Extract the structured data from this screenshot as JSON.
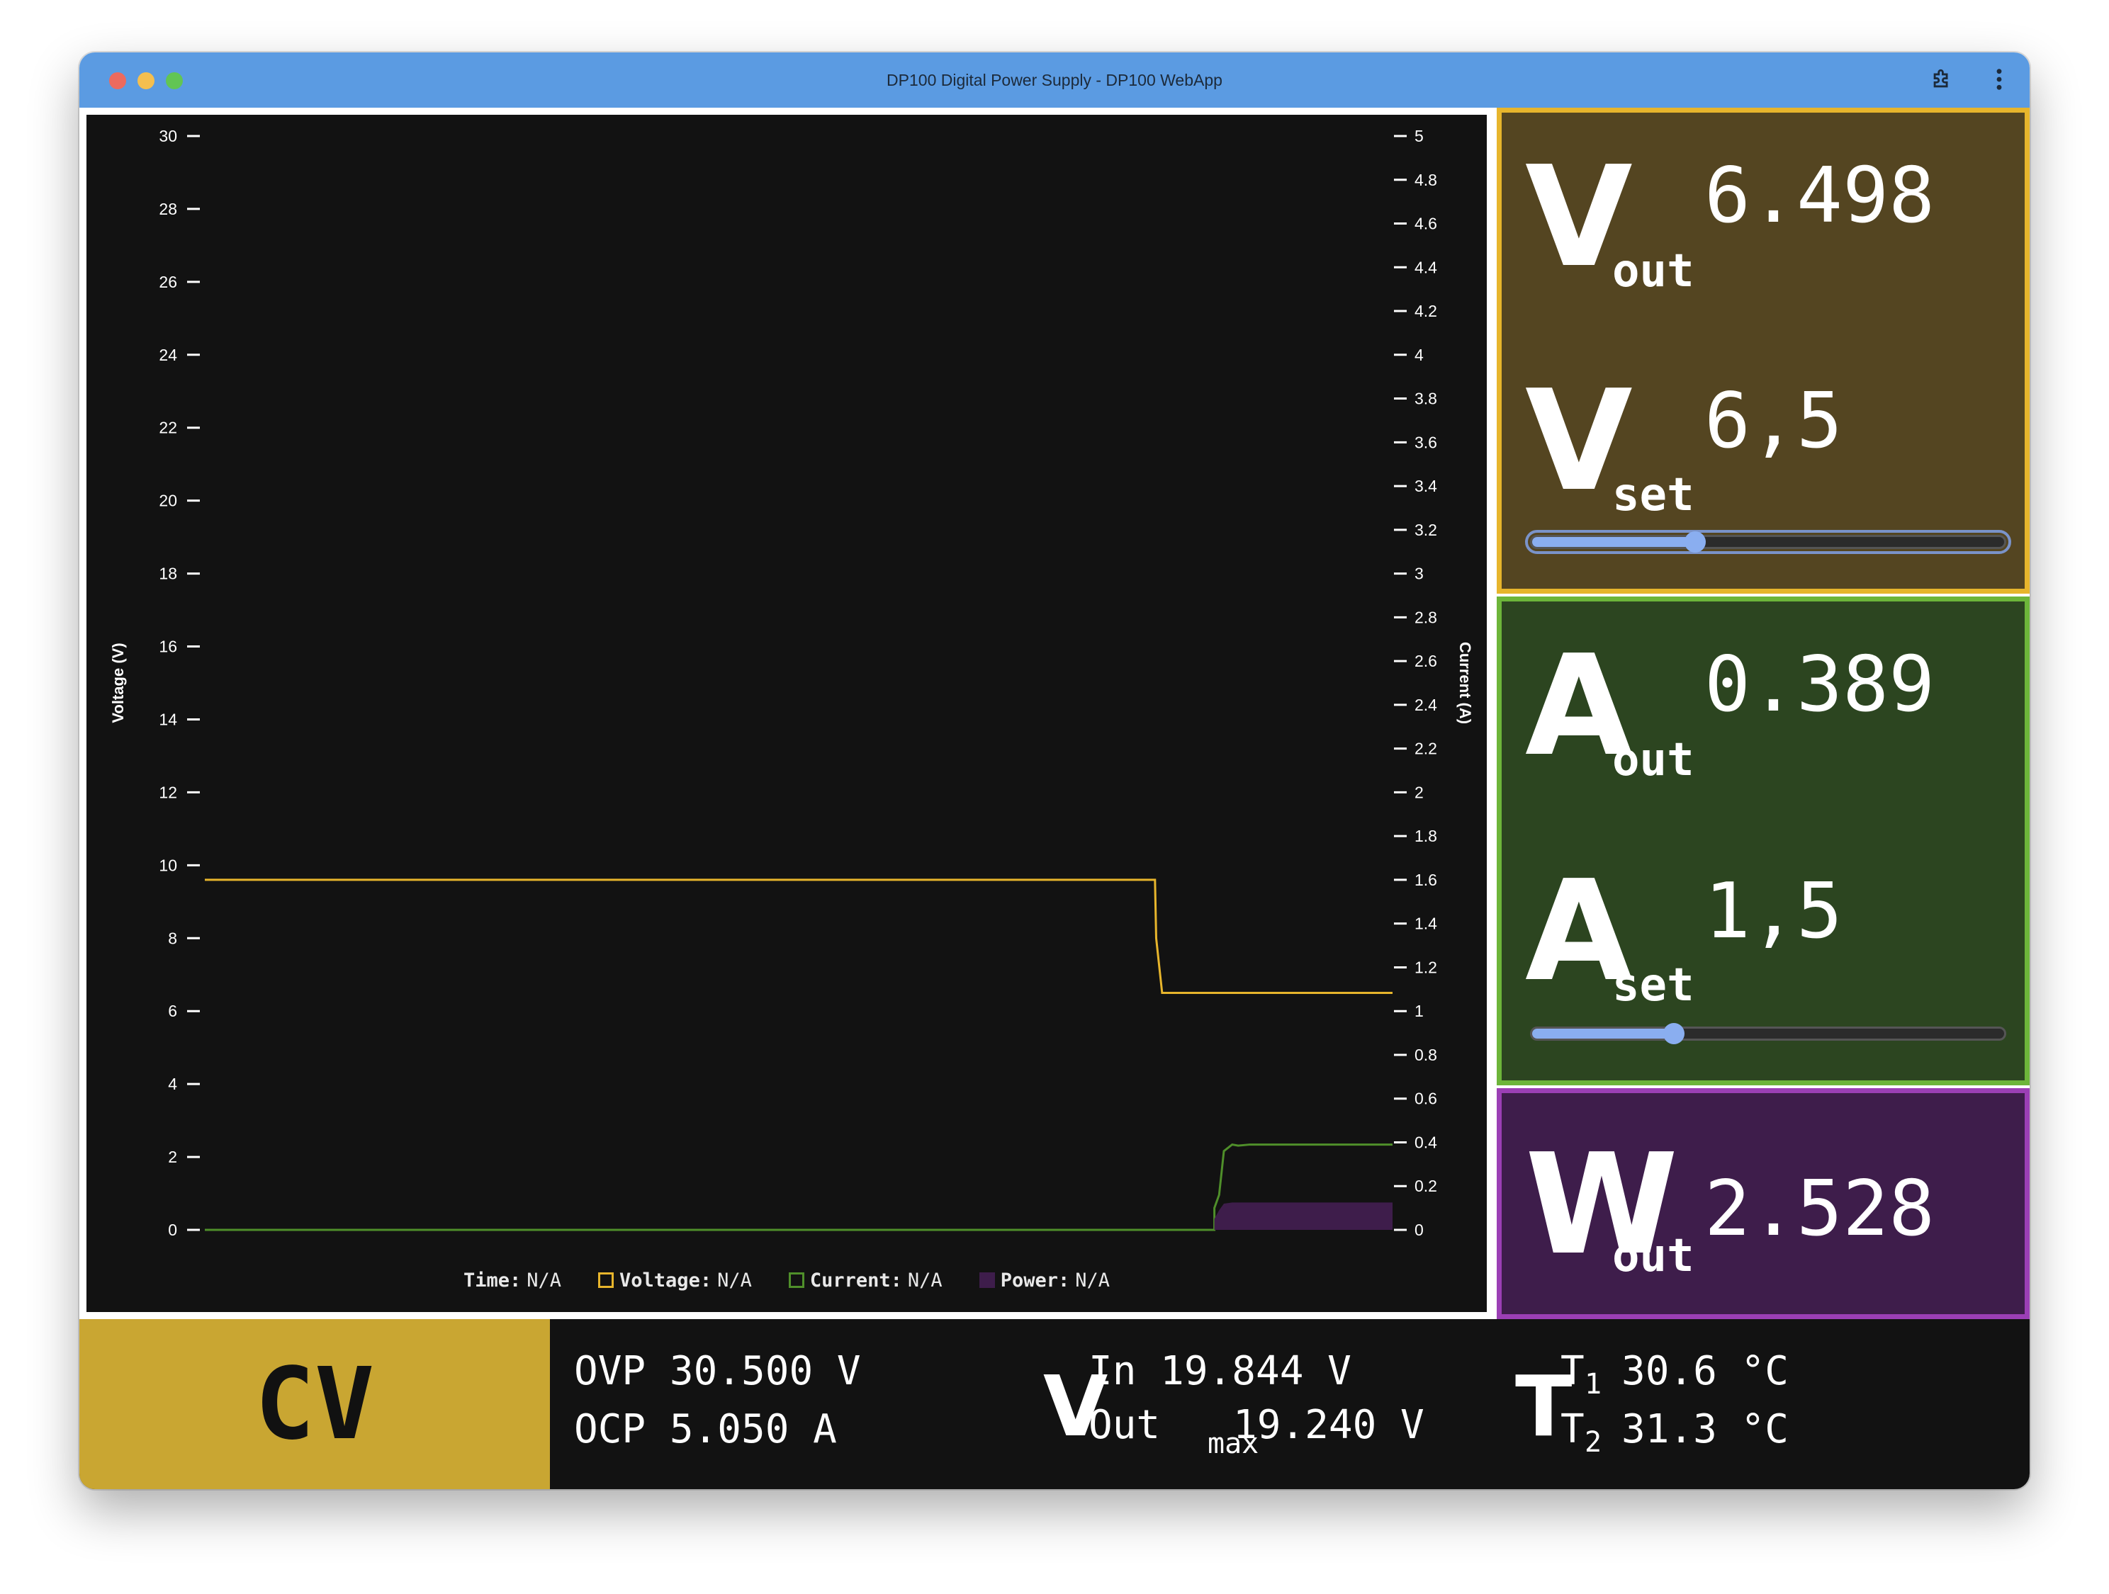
{
  "window": {
    "title": "DP100 Digital Power Supply - DP100 WebApp"
  },
  "chart_data": {
    "type": "line",
    "ylabel": "Voltage (V)",
    "y2label": "Current (A)",
    "ylim": [
      0,
      30
    ],
    "y2lim": [
      0,
      5
    ],
    "yticks": [
      "0",
      "2",
      "4",
      "6",
      "8",
      "10",
      "12",
      "14",
      "16",
      "18",
      "20",
      "22",
      "24",
      "26",
      "28",
      "30"
    ],
    "y2ticks": [
      "0",
      "0.2",
      "0.4",
      "0.6",
      "0.8",
      "1",
      "1.2",
      "1.4",
      "1.6",
      "1.8",
      "2",
      "2.2",
      "2.4",
      "2.6",
      "2.8",
      "3",
      "3.2",
      "3.4",
      "3.6",
      "3.8",
      "4",
      "4.2",
      "4.4",
      "4.6",
      "4.8",
      "5"
    ],
    "x": [
      0,
      0.8,
      0.801,
      0.806,
      0.85,
      0.85,
      0.854,
      0.858,
      0.865,
      0.87,
      0.88,
      1.0
    ],
    "series": [
      {
        "name": "Voltage",
        "axis": "left",
        "color": "#e7b52c",
        "values": [
          9.6,
          9.6,
          8.0,
          6.5,
          6.5,
          6.5,
          6.5,
          6.5,
          6.5,
          6.5,
          6.5,
          6.5
        ]
      },
      {
        "name": "Current",
        "axis": "right",
        "color": "#4f8f2a",
        "values": [
          0,
          0,
          0,
          0,
          0,
          0.1,
          0.16,
          0.36,
          0.39,
          0.385,
          0.39,
          0.39
        ]
      },
      {
        "name": "Power",
        "axis": "right",
        "color": "#3e1d4b",
        "fill": true,
        "values": [
          0,
          0,
          0,
          0,
          0,
          0.05,
          0.09,
          0.12,
          0.125,
          0.125,
          0.125,
          0.125
        ]
      }
    ],
    "legend": {
      "time_label": "Time:",
      "time_value": "N/A",
      "voltage_label": "Voltage:",
      "voltage_value": "N/A",
      "current_label": "Current:",
      "current_value": "N/A",
      "power_label": "Power:",
      "power_value": "N/A"
    }
  },
  "voltage_panel": {
    "letter": "V",
    "out_sub": "out",
    "out_value": "6.498",
    "set_sub": "set",
    "set_value": "6,5",
    "slider_fraction": 0.345
  },
  "current_panel": {
    "letter": "A",
    "out_sub": "out",
    "out_value": "0.389",
    "set_sub": "set",
    "set_value": "1,5",
    "slider_fraction": 0.3
  },
  "power_panel": {
    "letter": "W",
    "out_sub": "out",
    "out_value": "2.528"
  },
  "status": {
    "mode": "CV",
    "ovp_label": "OVP",
    "ovp_value": "30.500",
    "ovp_unit": "V",
    "ocp_label": "OCP",
    "ocp_value": "5.050",
    "ocp_unit": "A",
    "v_letter": "V",
    "vin_label": "In",
    "vin_value": "19.844",
    "vin_unit": "V",
    "voutmax_label": "Out",
    "voutmax_sub": "max",
    "voutmax_value": "19.240",
    "voutmax_unit": "V",
    "t_letter": "T",
    "t1_label": "T",
    "t1_sub": "1",
    "t1_value": "30.6",
    "t1_unit": "°C",
    "t2_label": "T",
    "t2_sub": "2",
    "t2_value": "31.3",
    "t2_unit": "°C"
  }
}
